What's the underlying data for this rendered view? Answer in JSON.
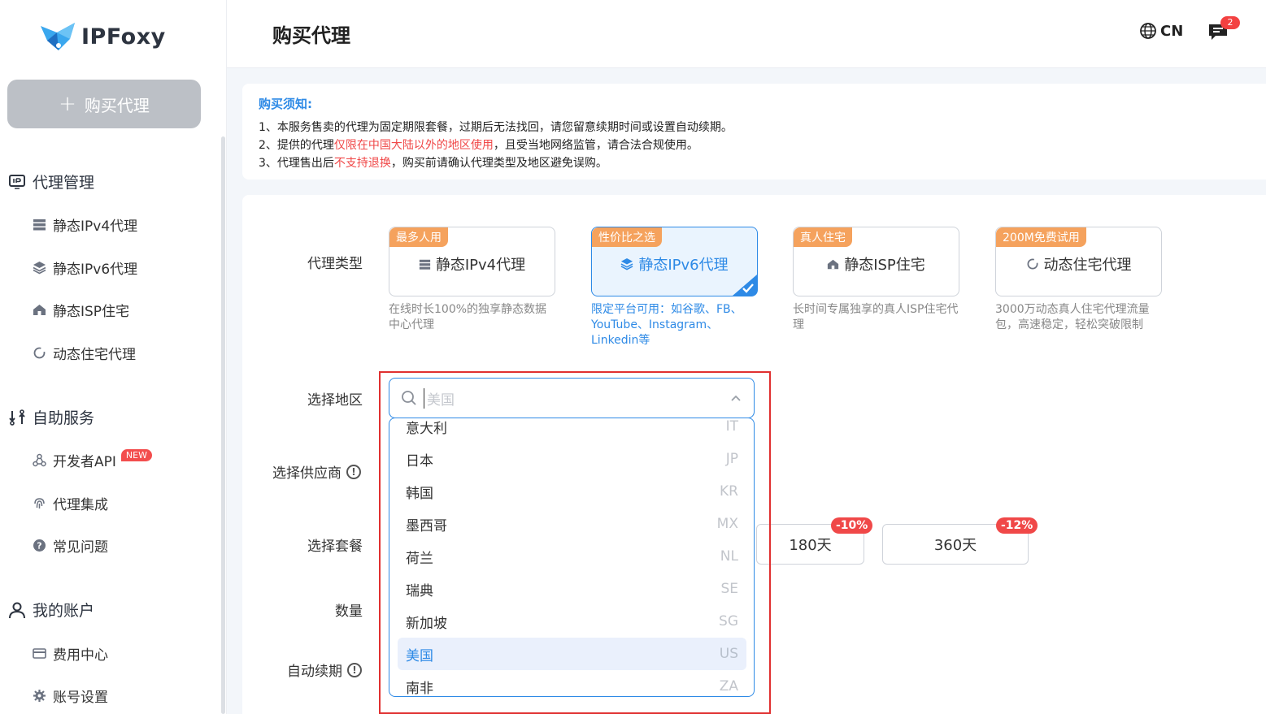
{
  "brand": {
    "name": "IPFoxy"
  },
  "sidebar": {
    "buy_button": "购买代理",
    "sections": [
      {
        "title": "代理管理",
        "items": [
          "静态IPv4代理",
          "静态IPv6代理",
          "静态ISP住宅",
          "动态住宅代理"
        ]
      },
      {
        "title": "自助服务",
        "items": [
          "开发者API",
          "代理集成",
          "常见问题"
        ],
        "new_badge": "NEW"
      },
      {
        "title": "我的账户",
        "items": [
          "费用中心",
          "账号设置"
        ]
      }
    ]
  },
  "header": {
    "title": "购买代理",
    "lang": "CN",
    "message_count": "2"
  },
  "notice": {
    "title": "购买须知:",
    "line1": "1、本服务售卖的代理为固定期限套餐，过期后无法找回，请您留意续期时间或设置自动续期。",
    "line2_a": "2、提供的代理",
    "line2_red": "仅限在中国大陆以外的地区使用",
    "line2_b": "，且受当地网络监管，请合法合规使用。",
    "line3_a": "3、代理售出后",
    "line3_red": "不支持退换",
    "line3_b": "，购买前请确认代理类型及地区避免误购。"
  },
  "form": {
    "proxy_type_label": "代理类型",
    "region_label": "选择地区",
    "provider_label": "选择供应商",
    "plan_label": "选择套餐",
    "quantity_label": "数量",
    "auto_renew_label": "自动续期"
  },
  "proxy_types": [
    {
      "tag": "最多人用",
      "name": "静态IPv4代理",
      "desc": "在线时长100%的独享静态数据中心代理"
    },
    {
      "tag": "性价比之选",
      "name": "静态IPv6代理",
      "desc": "限定平台可用：如谷歌、FB、YouTube、Instagram、Linkedin等",
      "selected": true
    },
    {
      "tag": "真人住宅",
      "name": "静态ISP住宅",
      "desc": "长时间专属独享的真人ISP住宅代理"
    },
    {
      "tag": "200M免费试用",
      "name": "动态住宅代理",
      "desc": "3000万动态真人住宅代理流量包，高速稳定，轻松突破限制"
    }
  ],
  "plans": [
    {
      "label": "180天",
      "discount": "-10%"
    },
    {
      "label": "360天",
      "discount": "-12%"
    }
  ],
  "region_select": {
    "placeholder": "美国",
    "options": [
      {
        "name": "意大利",
        "code": "IT"
      },
      {
        "name": "日本",
        "code": "JP"
      },
      {
        "name": "韩国",
        "code": "KR"
      },
      {
        "name": "墨西哥",
        "code": "MX"
      },
      {
        "name": "荷兰",
        "code": "NL"
      },
      {
        "name": "瑞典",
        "code": "SE"
      },
      {
        "name": "新加坡",
        "code": "SG"
      },
      {
        "name": "美国",
        "code": "US",
        "selected": true
      },
      {
        "name": "南非",
        "code": "ZA"
      }
    ]
  },
  "colors": {
    "accent": "#2e8ae6",
    "danger": "#f04848",
    "tag": "#f5a25d"
  }
}
